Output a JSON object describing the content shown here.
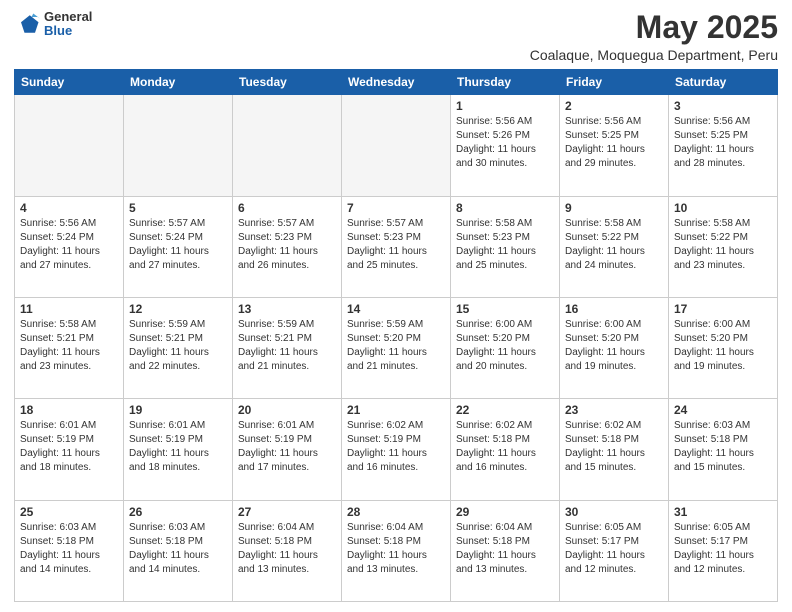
{
  "header": {
    "logo_general": "General",
    "logo_blue": "Blue",
    "month_year": "May 2025",
    "location": "Coalaque, Moquegua Department, Peru"
  },
  "weekdays": [
    "Sunday",
    "Monday",
    "Tuesday",
    "Wednesday",
    "Thursday",
    "Friday",
    "Saturday"
  ],
  "weeks": [
    [
      {
        "day": "",
        "empty": true
      },
      {
        "day": "",
        "empty": true
      },
      {
        "day": "",
        "empty": true
      },
      {
        "day": "",
        "empty": true
      },
      {
        "day": "1",
        "sunrise": "5:56 AM",
        "sunset": "5:26 PM",
        "daylight": "11 hours and 30 minutes."
      },
      {
        "day": "2",
        "sunrise": "5:56 AM",
        "sunset": "5:25 PM",
        "daylight": "11 hours and 29 minutes."
      },
      {
        "day": "3",
        "sunrise": "5:56 AM",
        "sunset": "5:25 PM",
        "daylight": "11 hours and 28 minutes."
      }
    ],
    [
      {
        "day": "4",
        "sunrise": "5:56 AM",
        "sunset": "5:24 PM",
        "daylight": "11 hours and 27 minutes."
      },
      {
        "day": "5",
        "sunrise": "5:57 AM",
        "sunset": "5:24 PM",
        "daylight": "11 hours and 27 minutes."
      },
      {
        "day": "6",
        "sunrise": "5:57 AM",
        "sunset": "5:23 PM",
        "daylight": "11 hours and 26 minutes."
      },
      {
        "day": "7",
        "sunrise": "5:57 AM",
        "sunset": "5:23 PM",
        "daylight": "11 hours and 25 minutes."
      },
      {
        "day": "8",
        "sunrise": "5:58 AM",
        "sunset": "5:23 PM",
        "daylight": "11 hours and 25 minutes."
      },
      {
        "day": "9",
        "sunrise": "5:58 AM",
        "sunset": "5:22 PM",
        "daylight": "11 hours and 24 minutes."
      },
      {
        "day": "10",
        "sunrise": "5:58 AM",
        "sunset": "5:22 PM",
        "daylight": "11 hours and 23 minutes."
      }
    ],
    [
      {
        "day": "11",
        "sunrise": "5:58 AM",
        "sunset": "5:21 PM",
        "daylight": "11 hours and 23 minutes."
      },
      {
        "day": "12",
        "sunrise": "5:59 AM",
        "sunset": "5:21 PM",
        "daylight": "11 hours and 22 minutes."
      },
      {
        "day": "13",
        "sunrise": "5:59 AM",
        "sunset": "5:21 PM",
        "daylight": "11 hours and 21 minutes."
      },
      {
        "day": "14",
        "sunrise": "5:59 AM",
        "sunset": "5:20 PM",
        "daylight": "11 hours and 21 minutes."
      },
      {
        "day": "15",
        "sunrise": "6:00 AM",
        "sunset": "5:20 PM",
        "daylight": "11 hours and 20 minutes."
      },
      {
        "day": "16",
        "sunrise": "6:00 AM",
        "sunset": "5:20 PM",
        "daylight": "11 hours and 19 minutes."
      },
      {
        "day": "17",
        "sunrise": "6:00 AM",
        "sunset": "5:20 PM",
        "daylight": "11 hours and 19 minutes."
      }
    ],
    [
      {
        "day": "18",
        "sunrise": "6:01 AM",
        "sunset": "5:19 PM",
        "daylight": "11 hours and 18 minutes."
      },
      {
        "day": "19",
        "sunrise": "6:01 AM",
        "sunset": "5:19 PM",
        "daylight": "11 hours and 18 minutes."
      },
      {
        "day": "20",
        "sunrise": "6:01 AM",
        "sunset": "5:19 PM",
        "daylight": "11 hours and 17 minutes."
      },
      {
        "day": "21",
        "sunrise": "6:02 AM",
        "sunset": "5:19 PM",
        "daylight": "11 hours and 16 minutes."
      },
      {
        "day": "22",
        "sunrise": "6:02 AM",
        "sunset": "5:18 PM",
        "daylight": "11 hours and 16 minutes."
      },
      {
        "day": "23",
        "sunrise": "6:02 AM",
        "sunset": "5:18 PM",
        "daylight": "11 hours and 15 minutes."
      },
      {
        "day": "24",
        "sunrise": "6:03 AM",
        "sunset": "5:18 PM",
        "daylight": "11 hours and 15 minutes."
      }
    ],
    [
      {
        "day": "25",
        "sunrise": "6:03 AM",
        "sunset": "5:18 PM",
        "daylight": "11 hours and 14 minutes."
      },
      {
        "day": "26",
        "sunrise": "6:03 AM",
        "sunset": "5:18 PM",
        "daylight": "11 hours and 14 minutes."
      },
      {
        "day": "27",
        "sunrise": "6:04 AM",
        "sunset": "5:18 PM",
        "daylight": "11 hours and 13 minutes."
      },
      {
        "day": "28",
        "sunrise": "6:04 AM",
        "sunset": "5:18 PM",
        "daylight": "11 hours and 13 minutes."
      },
      {
        "day": "29",
        "sunrise": "6:04 AM",
        "sunset": "5:18 PM",
        "daylight": "11 hours and 13 minutes."
      },
      {
        "day": "30",
        "sunrise": "6:05 AM",
        "sunset": "5:17 PM",
        "daylight": "11 hours and 12 minutes."
      },
      {
        "day": "31",
        "sunrise": "6:05 AM",
        "sunset": "5:17 PM",
        "daylight": "11 hours and 12 minutes."
      }
    ]
  ]
}
